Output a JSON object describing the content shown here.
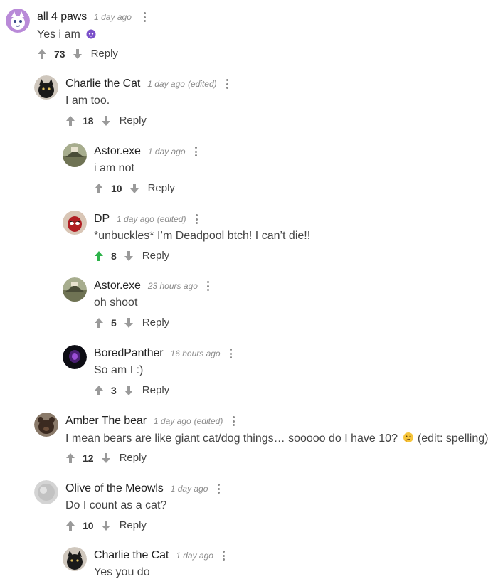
{
  "colors": {
    "upvote_default": "#9a9a9a",
    "upvote_active": "#2db34a",
    "downvote": "#9a9a9a"
  },
  "comments": [
    {
      "author": "all 4 paws",
      "time": "1 day ago",
      "edited": "",
      "text": "Yes i am",
      "votes": "73",
      "reply": "Reply",
      "emoji": "smiling-imp-emoji",
      "upvoted": false
    },
    {
      "author": "Charlie the Cat",
      "time": "1 day ago",
      "edited": "(edited)",
      "text": "I am too.",
      "votes": "18",
      "reply": "Reply",
      "upvoted": false
    },
    {
      "author": "Astor.exe",
      "time": "1 day ago",
      "edited": "",
      "text": "i am not",
      "votes": "10",
      "reply": "Reply",
      "upvoted": false
    },
    {
      "author": "DP",
      "time": "1 day ago",
      "edited": "(edited)",
      "text": "*unbuckles* I’m Deadpool btch! I can’t die!!",
      "votes": "8",
      "reply": "Reply",
      "upvoted": true
    },
    {
      "author": "Astor.exe",
      "time": "23 hours ago",
      "edited": "",
      "text": "oh shoot",
      "votes": "5",
      "reply": "Reply",
      "upvoted": false
    },
    {
      "author": "BoredPanther",
      "time": "16 hours ago",
      "edited": "",
      "text": "So am I :)",
      "votes": "3",
      "reply": "Reply",
      "upvoted": false
    },
    {
      "author": "Amber The bear",
      "time": "1 day ago",
      "edited": "(edited)",
      "text": "I mean bears are like giant cat/dog things… sooooo do I have 10?",
      "text_suffix": "(edit: spelling)",
      "emoji": "thinking-face-emoji",
      "votes": "12",
      "reply": "Reply",
      "upvoted": false
    },
    {
      "author": "Olive of the Meowls",
      "time": "1 day ago",
      "edited": "",
      "text": "Do I count as a cat?",
      "votes": "10",
      "reply": "Reply",
      "upvoted": false
    },
    {
      "author": "Charlie the Cat",
      "time": "1 day ago",
      "edited": "",
      "text": "Yes you do",
      "votes": "",
      "reply": "",
      "upvoted": false
    }
  ]
}
